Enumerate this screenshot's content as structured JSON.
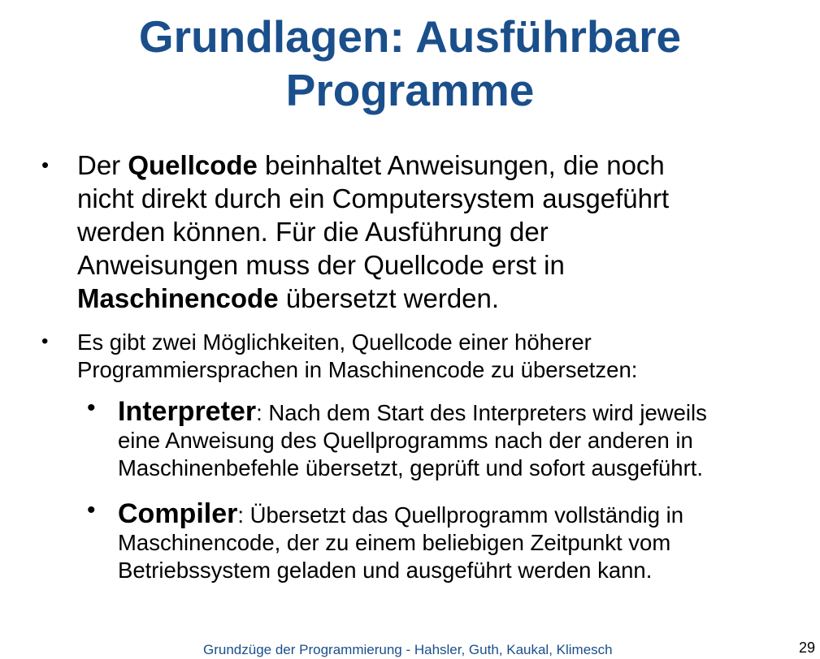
{
  "title": {
    "line1": "Grundlagen: Ausführbare",
    "line2": "Programme"
  },
  "bullet_glyph": "•",
  "bullet1": {
    "line1_pre": "Der ",
    "line1_bold": "Quellcode",
    "line1_post": " beinhaltet Anweisungen, die noch",
    "line2": "nicht direkt durch ein Computersystem ausgeführt",
    "line3": "werden können. Für die Ausführung der",
    "line4": "Anweisungen muss der Quellcode erst in",
    "line5_bold": "Maschinencode",
    "line5_post": " übersetzt werden."
  },
  "bullet2": {
    "line1": "Es gibt zwei Möglichkeiten, Quellcode einer höherer",
    "line2": "Programmiersprachen in Maschinencode zu übersetzen:"
  },
  "subbullet_interpreter": {
    "term": "Interpreter",
    "line1_post": ": Nach dem Start des Interpreters wird jeweils",
    "line2": "eine Anweisung des Quellprogramms nach der anderen in",
    "line3": "Maschinenbefehle übersetzt, geprüft und sofort ausgeführt."
  },
  "subbullet_compiler": {
    "term": "Compiler",
    "line1_post": ": Übersetzt das Quellprogramm vollständig in",
    "line2": "Maschinencode, der zu einem beliebigen Zeitpunkt vom",
    "line3": "Betriebssystem geladen und ausgeführt werden kann."
  },
  "footer": {
    "text": "Grundzüge der Programmierung  - Hahsler, Guth, Kaukal, Klimesch",
    "page_number": "29"
  },
  "colors": {
    "title": "#1a4f8b",
    "body_text": "#000000",
    "background": "#ffffff"
  }
}
